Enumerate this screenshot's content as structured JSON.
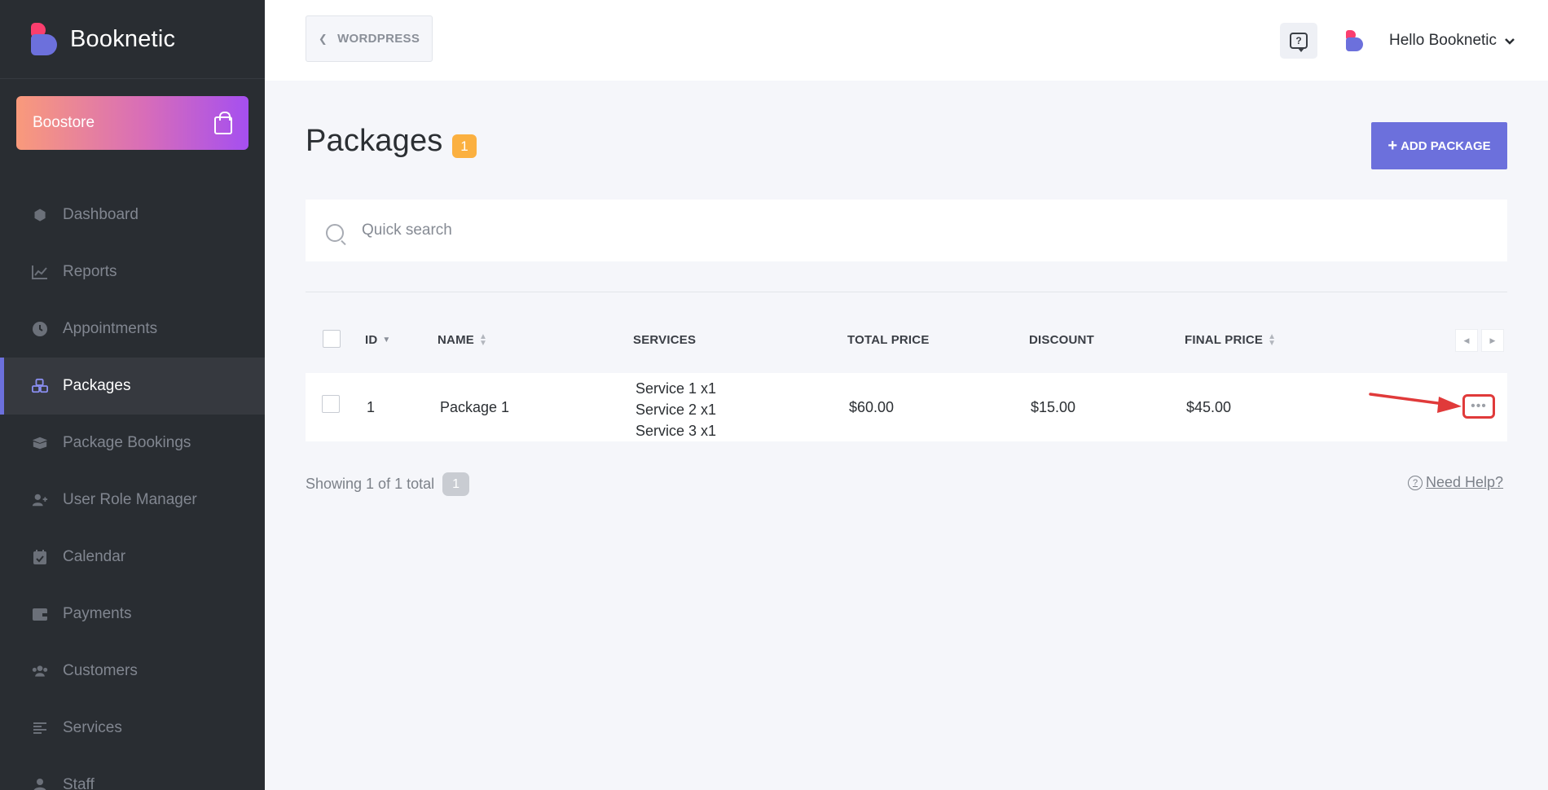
{
  "brand": {
    "name": "Booknetic"
  },
  "boostore": {
    "label": "Boostore",
    "icon": "shopping-bag-icon"
  },
  "sidebar": {
    "items": [
      {
        "label": "Dashboard",
        "icon": "cube-icon",
        "glyph": "⬢"
      },
      {
        "label": "Reports",
        "icon": "chart-line-icon",
        "glyph": "📈"
      },
      {
        "label": "Appointments",
        "icon": "clock-icon",
        "glyph": "◷"
      },
      {
        "label": "Packages",
        "icon": "cubes-icon",
        "glyph": "⁂"
      },
      {
        "label": "Package Bookings",
        "icon": "boxes-icon",
        "glyph": "▣"
      },
      {
        "label": "User Role Manager",
        "icon": "user-plus-icon",
        "glyph": "👤"
      },
      {
        "label": "Calendar",
        "icon": "calendar-check-icon",
        "glyph": "▦"
      },
      {
        "label": "Payments",
        "icon": "wallet-icon",
        "glyph": "▤"
      },
      {
        "label": "Customers",
        "icon": "users-icon",
        "glyph": "👥"
      },
      {
        "label": "Services",
        "icon": "align-left-icon",
        "glyph": "≡"
      },
      {
        "label": "Staff",
        "icon": "user-icon",
        "glyph": "👤"
      }
    ],
    "active_index": 3
  },
  "header": {
    "back_label": "WORDPRESS",
    "user_greeting": "Hello Booknetic",
    "help_icon": "question-bubble-icon"
  },
  "page": {
    "title": "Packages",
    "count": "1",
    "add_button": "ADD PACKAGE"
  },
  "search": {
    "placeholder": "Quick search",
    "value": ""
  },
  "table": {
    "columns": [
      "ID",
      "NAME",
      "SERVICES",
      "TOTAL PRICE",
      "DISCOUNT",
      "FINAL PRICE"
    ],
    "rows": [
      {
        "id": "1",
        "name": "Package 1",
        "services": [
          "Service 1 x1",
          "Service 2 x1",
          "Service 3 x1"
        ],
        "total_price": "$60.00",
        "discount": "$15.00",
        "final_price": "$45.00"
      }
    ]
  },
  "footer": {
    "showing": "Showing 1 of 1 total",
    "page": "1",
    "need_help": "Need Help?"
  },
  "colors": {
    "accent": "#6c70dc",
    "badge": "#fbb040",
    "highlight": "#e03a3a"
  }
}
